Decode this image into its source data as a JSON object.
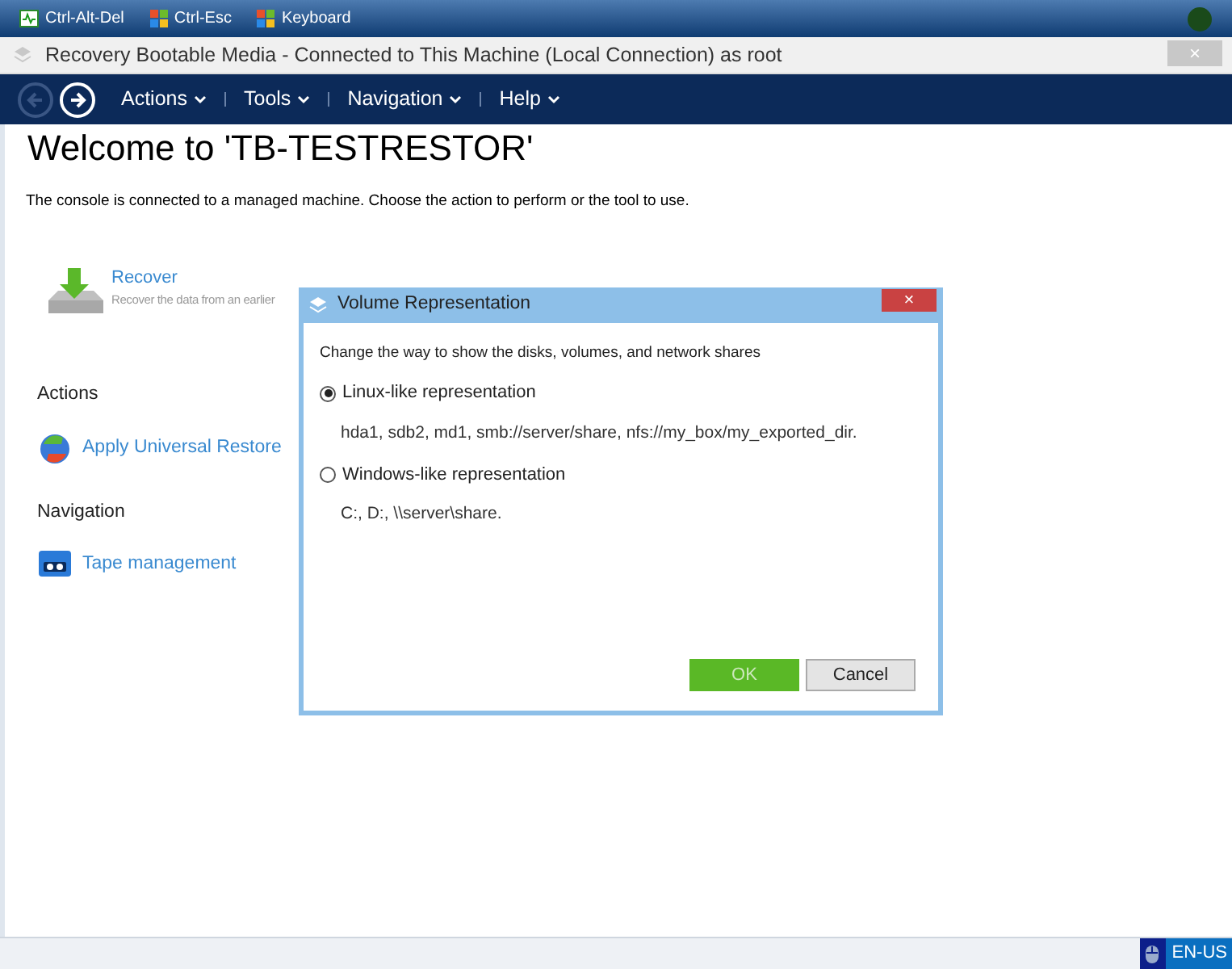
{
  "taskbar": {
    "buttons": [
      {
        "label": "Ctrl-Alt-Del",
        "kind": "monitor"
      },
      {
        "label": "Ctrl-Esc",
        "kind": "windows"
      },
      {
        "label": "Keyboard",
        "kind": "windows"
      }
    ]
  },
  "window": {
    "title": "Recovery Bootable Media - Connected to This Machine (Local Connection) as root",
    "close": "×"
  },
  "navbar": {
    "back_disabled": true,
    "menus": [
      "Actions",
      "Tools",
      "Navigation",
      "Help"
    ]
  },
  "page": {
    "heading": "Welcome to 'TB-TESTRESTOR'",
    "intro": "The console is connected to a managed machine. Choose the action to perform or the tool to use.",
    "recover": {
      "label": "Recover",
      "description": "Recover the data from an earlier"
    },
    "sections": [
      {
        "title": "Actions",
        "items": [
          {
            "label": "Apply Universal Restore",
            "kind": "restore"
          }
        ]
      },
      {
        "title": "Navigation",
        "items": [
          {
            "label": "Tape management",
            "kind": "tape"
          }
        ]
      }
    ]
  },
  "dialog": {
    "title": "Volume Representation",
    "close": "×",
    "prompt": "Change the way to show the disks, volumes, and network shares",
    "options": [
      {
        "label": "Linux-like representation",
        "example": "hda1, sdb2, md1, smb://server/share, nfs://my_box/my_exported_dir.",
        "selected": true
      },
      {
        "label": "Windows-like representation",
        "example": "C:, D:, \\\\server\\share.",
        "selected": false
      }
    ],
    "buttons": [
      {
        "label": "OK",
        "kind": "primary"
      },
      {
        "label": "Cancel",
        "kind": "secondary"
      }
    ]
  },
  "status_bar": {
    "language": "EN-US"
  }
}
